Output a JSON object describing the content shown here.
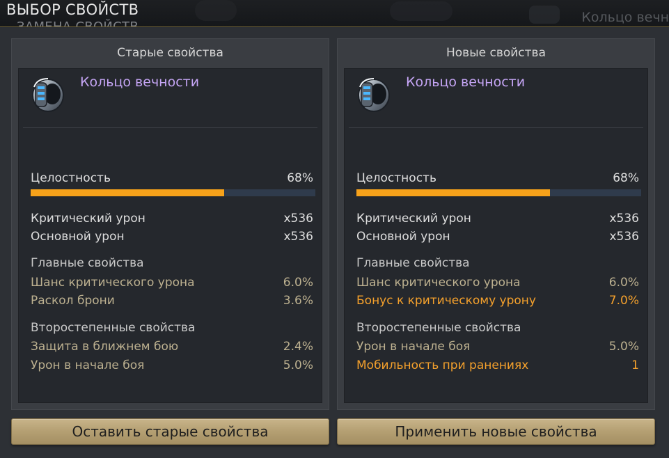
{
  "header": {
    "title": "ВЫБОР СВОЙСТВ",
    "subtitle": "ЗАМЕНА СВОЙСТВ",
    "right_label": "Кольцо вечн"
  },
  "colors": {
    "item_name": "#c6a6f6",
    "durability_fill": "#f7a21a",
    "durability_track": "#2f3b4c",
    "muted_stat": "#bdb190",
    "highlight_stat": "#f5a12c",
    "button": "#b49f72"
  },
  "panels": {
    "old": {
      "header": "Старые свойства",
      "item_name": "Кольцо вечности",
      "item_icon": "ring-icon",
      "durability_label": "Целостность",
      "durability_value": "68%",
      "durability_fraction": 0.68,
      "base_stats": [
        {
          "label": "Критический урон",
          "value": "x536"
        },
        {
          "label": "Основной урон",
          "value": "x536"
        }
      ],
      "main_title": "Главные свойства",
      "main_stats": [
        {
          "label": "Шанс критического урона",
          "value": "6.0%"
        },
        {
          "label": "Раскол брони",
          "value": "3.6%"
        }
      ],
      "secondary_title": "Второстепенные свойства",
      "secondary_stats": [
        {
          "label": "Защита в ближнем бою",
          "value": "2.4%"
        },
        {
          "label": "Урон в начале боя",
          "value": "5.0%"
        }
      ]
    },
    "new": {
      "header": "Новые свойства",
      "item_name": "Кольцо вечности",
      "item_icon": "ring-icon",
      "durability_label": "Целостность",
      "durability_value": "68%",
      "durability_fraction": 0.68,
      "base_stats": [
        {
          "label": "Критический урон",
          "value": "x536"
        },
        {
          "label": "Основной урон",
          "value": "x536"
        }
      ],
      "main_title": "Главные свойства",
      "main_stats": [
        {
          "label": "Шанс критического урона",
          "value": "6.0%"
        },
        {
          "label": "Бонус к критическому урону",
          "value": "7.0%"
        }
      ],
      "secondary_title": "Второстепенные свойства",
      "secondary_stats": [
        {
          "label": "Урон в начале боя",
          "value": "5.0%"
        },
        {
          "label": "Мобильность при ранениях",
          "value": "1"
        }
      ]
    }
  },
  "buttons": {
    "keep_old": "Оставить старые свойства",
    "apply_new": "Применить новые свойства"
  }
}
